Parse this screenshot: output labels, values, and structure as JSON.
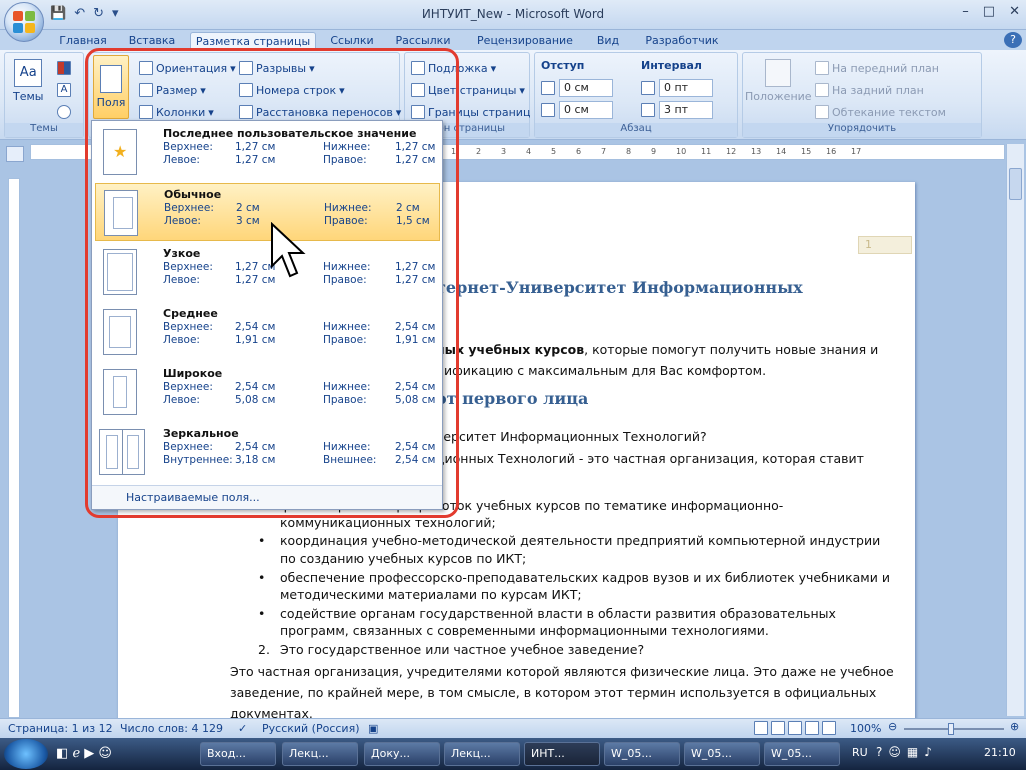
{
  "window": {
    "title": "ИНТУИТ_New - Microsoft Word",
    "minimize": "–",
    "maximize": "□",
    "close": "✕"
  },
  "tabs": [
    "Главная",
    "Вставка",
    "Разметка страницы",
    "Ссылки",
    "Рассылки",
    "Рецензирование",
    "Вид",
    "Разработчик"
  ],
  "ribbon": {
    "themes": {
      "label": "Темы",
      "group": "Темы"
    },
    "page_setup": {
      "margins": "Поля",
      "orientation": "Ориентация",
      "size": "Размер",
      "columns": "Колонки",
      "breaks": "Разрывы",
      "line_numbers": "Номера строк",
      "hyphenation": "Расстановка переносов"
    },
    "background": {
      "watermark": "Подложка",
      "page_color": "Цвет страницы",
      "page_borders": "Границы страниц",
      "group": "Фон страницы"
    },
    "paragraph": {
      "indent": "Отступ",
      "spacing": "Интервал",
      "indent_left": "0 см",
      "indent_right": "0 см",
      "spacing_before": "0 пт",
      "spacing_after": "3 пт",
      "group": "Абзац"
    },
    "arrange": {
      "position": "Положение",
      "bring_front": "На передний план",
      "send_back": "На задний план",
      "text_wrap": "Обтекание текстом",
      "group": "Упорядочить"
    }
  },
  "margins_menu": {
    "items": [
      {
        "name": "Последнее пользовательское значение",
        "l1a": "Верхнее:",
        "v1a": "1,27 см",
        "l1b": "Нижнее:",
        "v1b": "1,27 см",
        "l2a": "Левое:",
        "v2a": "1,27 см",
        "l2b": "Правое:",
        "v2b": "1,27 см"
      },
      {
        "name": "Обычное",
        "l1a": "Верхнее:",
        "v1a": "2 см",
        "l1b": "Нижнее:",
        "v1b": "2 см",
        "l2a": "Левое:",
        "v2a": "3 см",
        "l2b": "Правое:",
        "v2b": "1,5 см"
      },
      {
        "name": "Узкое",
        "l1a": "Верхнее:",
        "v1a": "1,27 см",
        "l1b": "Нижнее:",
        "v1b": "1,27 см",
        "l2a": "Левое:",
        "v2a": "1,27 см",
        "l2b": "Правое:",
        "v2b": "1,27 см"
      },
      {
        "name": "Среднее",
        "l1a": "Верхнее:",
        "v1a": "2,54 см",
        "l1b": "Нижнее:",
        "v1b": "2,54 см",
        "l2a": "Левое:",
        "v2a": "1,91 см",
        "l2b": "Правое:",
        "v2b": "1,91 см"
      },
      {
        "name": "Широкое",
        "l1a": "Верхнее:",
        "v1a": "2,54 см",
        "l1b": "Нижнее:",
        "v1b": "2,54 см",
        "l2a": "Левое:",
        "v2a": "5,08 см",
        "l2b": "Правое:",
        "v2b": "5,08 см"
      },
      {
        "name": "Зеркальное",
        "l1a": "Верхнее:",
        "v1a": "2,54 см",
        "l1b": "Нижнее:",
        "v1b": "2,54 см",
        "l2a": "Внутреннее:",
        "v2a": "3,18 см",
        "l2b": "Внешнее:",
        "v2b": "2,54 см"
      }
    ],
    "custom": "Настраиваемые поля..."
  },
  "ruler": {
    "marks": [
      "1",
      "2",
      "3",
      "4",
      "5",
      "6",
      "7",
      "8",
      "9",
      "10",
      "11",
      "12",
      "13",
      "14",
      "15",
      "16",
      "17"
    ]
  },
  "document": {
    "page_number": "1",
    "heading1": "тернет-Университет Информационных",
    "line1_bold": "ных учебных курсов",
    "line1_rest": ", которые помогут получить новые знания и",
    "line2": "лификацию с максимальным для Вас комфортом.",
    "heading2": "от первого лица",
    "line3": "верситет Информационных Технологий?",
    "line4": "ционных Технологий - это частная организация, которая ставит",
    "bullets": [
      "финансирование разработок учебных курсов по тематике информационно-",
      "коммуникационных технологий;",
      "координация учебно-методической деятельности предприятий компьютерной индустрии",
      "по созданию учебных курсов по ИКТ;",
      "обеспечение профессорско-преподавательских кадров вузов и их библиотек учебниками и",
      "методическими материалами по курсам ИКТ;",
      "содействие органам государственной власти в области развития образовательных",
      "программ, связанных с современными информационными технологиями."
    ],
    "num2": "2.",
    "q2": "Это государственное или частное учебное заведение?",
    "p1": "Это частная организация, учредителями которой являются физические лица. Это даже не учебное",
    "p2": "заведение, по крайней мере, в том смысле, в котором этот термин используется в официальных",
    "p3": "документах."
  },
  "status": {
    "page": "Страница: 1 из 12",
    "words": "Число слов: 4 129",
    "lang": "Русский (Россия)",
    "zoom": "100%"
  },
  "taskbar": {
    "items": [
      "Вход...",
      "Лекц...",
      "Доку...",
      "Лекц...",
      "ИНТ...",
      "W_05...",
      "W_05...",
      "W_05..."
    ],
    "lang": "RU",
    "time": "21:10"
  },
  "colors": {
    "accent": "#15428b",
    "highlight": "#ffd67a",
    "red_box": "#e23b2e"
  }
}
